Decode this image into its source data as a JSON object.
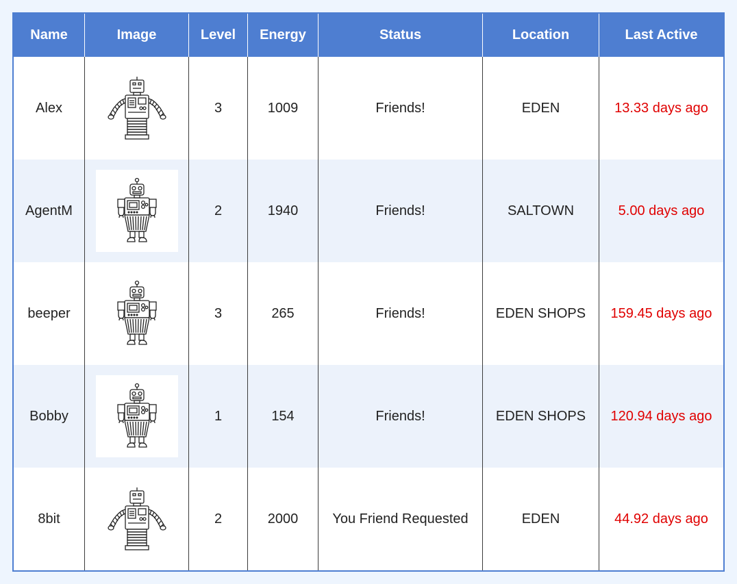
{
  "table": {
    "headers": {
      "name": "Name",
      "image": "Image",
      "level": "Level",
      "energy": "Energy",
      "status": "Status",
      "location": "Location",
      "last_active": "Last Active"
    },
    "rows": [
      {
        "name": "Alex",
        "image_icon": "robot-arms-out-icon",
        "level": "3",
        "energy": "1009",
        "status": "Friends!",
        "location": "EDEN",
        "last_active": "13.33 days ago"
      },
      {
        "name": "AgentM",
        "image_icon": "robot-skirt-icon",
        "level": "2",
        "energy": "1940",
        "status": "Friends!",
        "location": "SALTOWN",
        "last_active": "5.00 days ago"
      },
      {
        "name": "beeper",
        "image_icon": "robot-skirt-icon",
        "level": "3",
        "energy": "265",
        "status": "Friends!",
        "location": "EDEN SHOPS",
        "last_active": "159.45 days ago"
      },
      {
        "name": "Bobby",
        "image_icon": "robot-skirt-icon",
        "level": "1",
        "energy": "154",
        "status": "Friends!",
        "location": "EDEN SHOPS",
        "last_active": "120.94 days ago"
      },
      {
        "name": "8bit",
        "image_icon": "robot-arms-out-icon",
        "level": "2",
        "energy": "2000",
        "status": "You Friend Requested",
        "location": "EDEN",
        "last_active": "44.92 days ago"
      }
    ]
  },
  "colors": {
    "header_bg": "#4e7ed1",
    "alt_row_bg": "#ecf2fb",
    "last_active_text": "#e00000",
    "page_bg": "#eef5fe"
  }
}
